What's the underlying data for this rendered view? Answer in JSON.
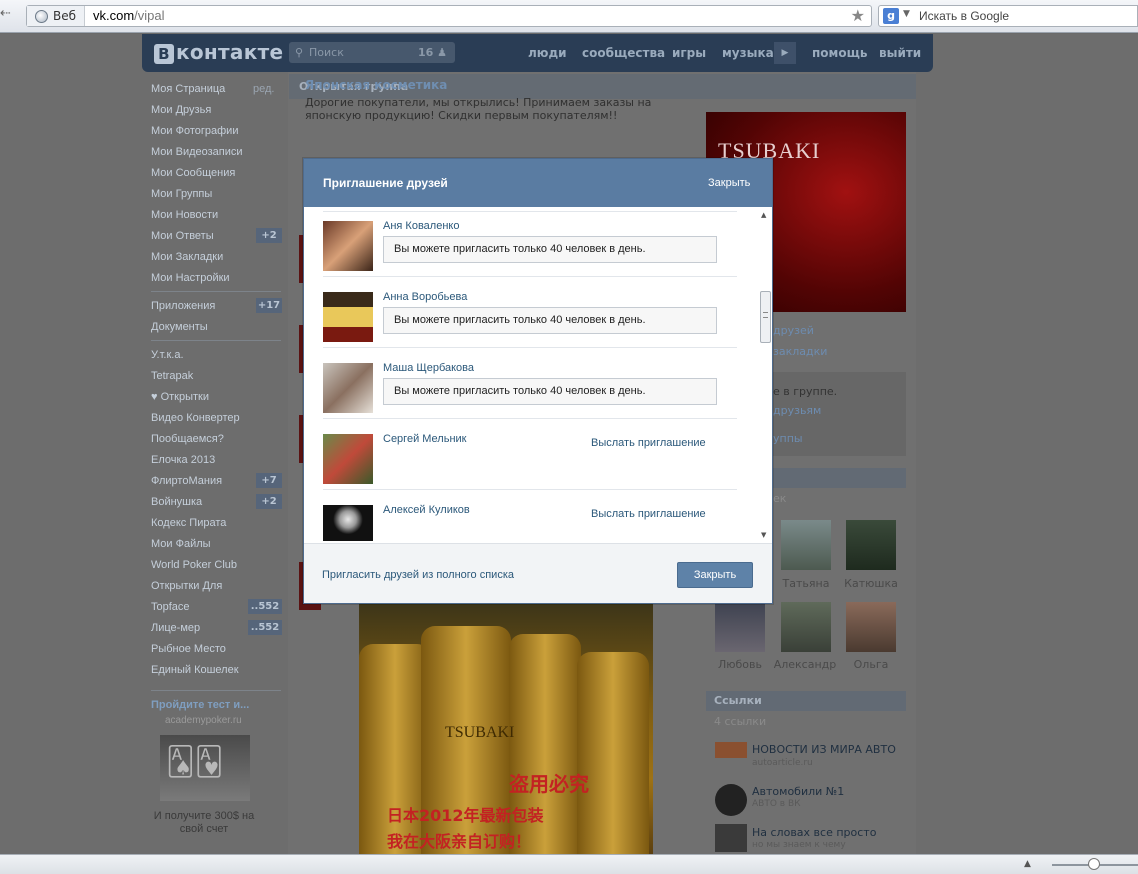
{
  "browser": {
    "tab_label": "Веб",
    "url_host": "vk.com",
    "url_path": "/vipal",
    "search_engine_letter": "g",
    "search_placeholder": "Искать в Google"
  },
  "vk_header": {
    "logo_letter": "В",
    "logo_text": "контакте",
    "search_placeholder": "Поиск",
    "search_count": "16",
    "nav": [
      "люди",
      "сообщества",
      "игры",
      "музыка",
      "помощь",
      "выйти"
    ]
  },
  "left_menu": {
    "my_page": "Моя Страница",
    "edit": "ред.",
    "items": [
      {
        "label": "Мои Друзья"
      },
      {
        "label": "Мои Фотографии"
      },
      {
        "label": "Мои Видеозаписи"
      },
      {
        "label": "Мои Сообщения"
      },
      {
        "label": "Мои Группы"
      },
      {
        "label": "Мои Новости"
      },
      {
        "label": "Мои Ответы",
        "badge": "+2"
      },
      {
        "label": "Мои Закладки"
      },
      {
        "label": "Мои Настройки"
      }
    ],
    "apps": [
      {
        "label": "Приложения",
        "badge": "+17"
      },
      {
        "label": "Документы"
      }
    ],
    "custom": [
      {
        "label": "У.т.к.а."
      },
      {
        "label": "Tetrapak"
      },
      {
        "label": "♥ Открытки"
      },
      {
        "label": "Видео Конвертер"
      },
      {
        "label": "Пообщаемся?"
      },
      {
        "label": "Елочка 2013"
      },
      {
        "label": "ФлиртоМания",
        "badge": "+7"
      },
      {
        "label": "Войнушка",
        "badge": "+2"
      },
      {
        "label": "Кодекс Пирата"
      },
      {
        "label": "Мои Файлы"
      },
      {
        "label": "World Poker Club"
      },
      {
        "label": "Открытки Для"
      },
      {
        "label": "Topface",
        "badge": "..552"
      },
      {
        "label": "Лице-мер",
        "badge": "..552"
      },
      {
        "label": "Рыбное Место"
      },
      {
        "label": "Единый Кошелек"
      }
    ],
    "ad": {
      "title": "Пройдите тест и...",
      "domain": "academypoker.ru",
      "text": "И получите 300$ на свой счет"
    }
  },
  "group": {
    "type_label": "Открытая группа",
    "title": "Японская косметика",
    "description": "Дорогие покупатели, мы открылись! Принимаем заказы на японскую продукцию! Скидки первым покупателям!!",
    "top_image_text": "TSUBAKI",
    "bottle_text": "TSUBAKI",
    "cn_line1": "盗用必究",
    "cn_line2": "日本2012年最新包装",
    "cn_line3": "我在大阪亲自订购！"
  },
  "right_col": {
    "side_links": [
      "друзей",
      "закладки"
    ],
    "member_text": "е в группе.",
    "member_link1": "друзьям",
    "member_link2": "уппы",
    "participants_count": "ек",
    "friends": [
      {
        "name": "Татьяна"
      },
      {
        "name": "Катюшка"
      },
      {
        "name": "Любовь"
      },
      {
        "name": "Александр"
      },
      {
        "name": "Ольга"
      }
    ],
    "links_header": "Ссылки",
    "links_count": "4 ссылки",
    "links": [
      {
        "title": "НОВОСТИ ИЗ МИРА АВТО",
        "sub": "autoarticle.ru"
      },
      {
        "title": "Автомобили №1",
        "sub": "АВТО в ВК"
      },
      {
        "title": "На словах все просто",
        "sub": "но мы знаем к чему"
      }
    ]
  },
  "modal": {
    "title": "Приглашение друзей",
    "close_link": "Закрыть",
    "notice": "Вы можете пригласить только 40 человек в день.",
    "invite_label": "Выслать приглашение",
    "rows": [
      {
        "name": "Аня Коваленко",
        "state": "limit"
      },
      {
        "name": "Анна Воробьева",
        "state": "limit"
      },
      {
        "name": "Маша Щербакова",
        "state": "limit"
      },
      {
        "name": "Сергей Мельник",
        "state": "invite"
      },
      {
        "name": "Алексей Куликов",
        "state": "invite"
      }
    ],
    "footer_link": "Пригласить друзей из полного списка",
    "close_button": "Закрыть"
  },
  "colors": {
    "modal_header": "#5a7ca2",
    "link": "#2b587a",
    "vk_header": "#2a3d55"
  }
}
